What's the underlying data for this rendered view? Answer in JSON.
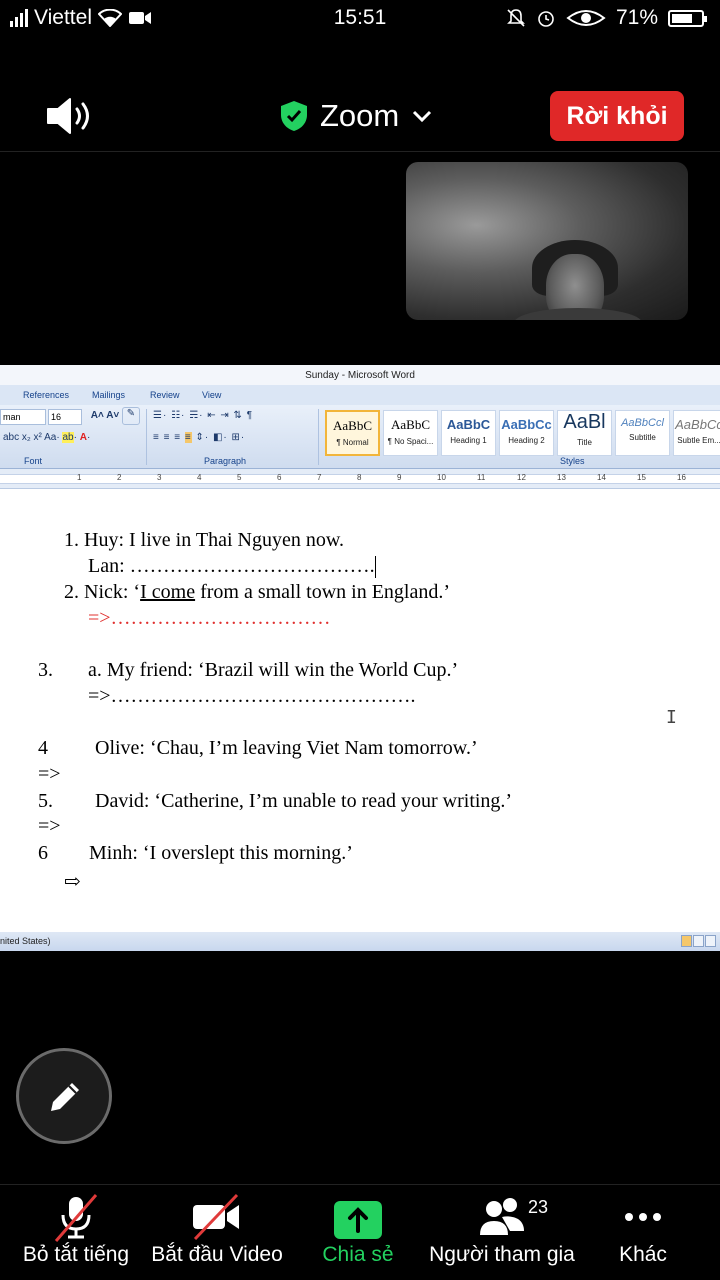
{
  "status_bar": {
    "carrier": "Viettel",
    "time": "15:51",
    "battery": "71%",
    "battery_level": 0.71
  },
  "top_bar": {
    "meeting_title": "Zoom",
    "leave_label": "Rời khỏi"
  },
  "word": {
    "window_title": "Sunday - Microsoft Word",
    "tabs": [
      "References",
      "Mailings",
      "Review",
      "View"
    ],
    "font_name": "man",
    "font_size": "16",
    "group_font": "Font",
    "group_paragraph": "Paragraph",
    "group_styles": "Styles",
    "styles": [
      {
        "sample": "AaBbC",
        "name": "¶ Normal"
      },
      {
        "sample": "AaBbC",
        "name": "¶ No Spaci..."
      },
      {
        "sample": "AaBbC",
        "name": "Heading 1"
      },
      {
        "sample": "AaBbCc",
        "name": "Heading 2"
      },
      {
        "sample": "AaBl",
        "name": "Title"
      },
      {
        "sample": "AaBbCcl",
        "name": "Subtitle"
      },
      {
        "sample": "AaBbCc",
        "name": "Subtle Em..."
      }
    ],
    "ruler_numbers": [
      "1",
      "2",
      "3",
      "4",
      "5",
      "6",
      "7",
      "8",
      "9",
      "10",
      "11",
      "12",
      "13",
      "14",
      "15",
      "16"
    ],
    "status_language": "nited States)",
    "document": {
      "l1": "1.  Huy: I live in Thai Nguyen now.",
      "l2": "Lan: ……………………………….",
      "l3a": "2.  Nick: ‘",
      "l3b": "I come",
      "l3c": " from a small town in England.’",
      "l4": "=>……………………………",
      "l5a": "3.",
      "l5b": "a. My friend: ‘Brazil will win the World Cup.’",
      "l6": "=>……………………………………….",
      "l7a": "4",
      "l7b": "Olive: ‘Chau, I’m leaving Viet Nam tomorrow.’",
      "l8": "=>",
      "l9a": "5.",
      "l9b": "David: ‘Catherine, I’m unable to read your writing.’",
      "l10": "=>",
      "l11a": "6",
      "l11b": "Minh: ‘I overslept this morning.’",
      "l12": "⇨"
    }
  },
  "toolbar": {
    "mute_label": "Bỏ tắt tiếng",
    "video_label": "Bắt đầu Video",
    "share_label": "Chia sẻ",
    "participants_label": "Người tham gia",
    "participants_count": "23",
    "more_label": "Khác"
  },
  "colors": {
    "leave": "#e02828",
    "share_green": "#23d160",
    "shield_green": "#23d160",
    "muted_red": "#e03a3a"
  }
}
